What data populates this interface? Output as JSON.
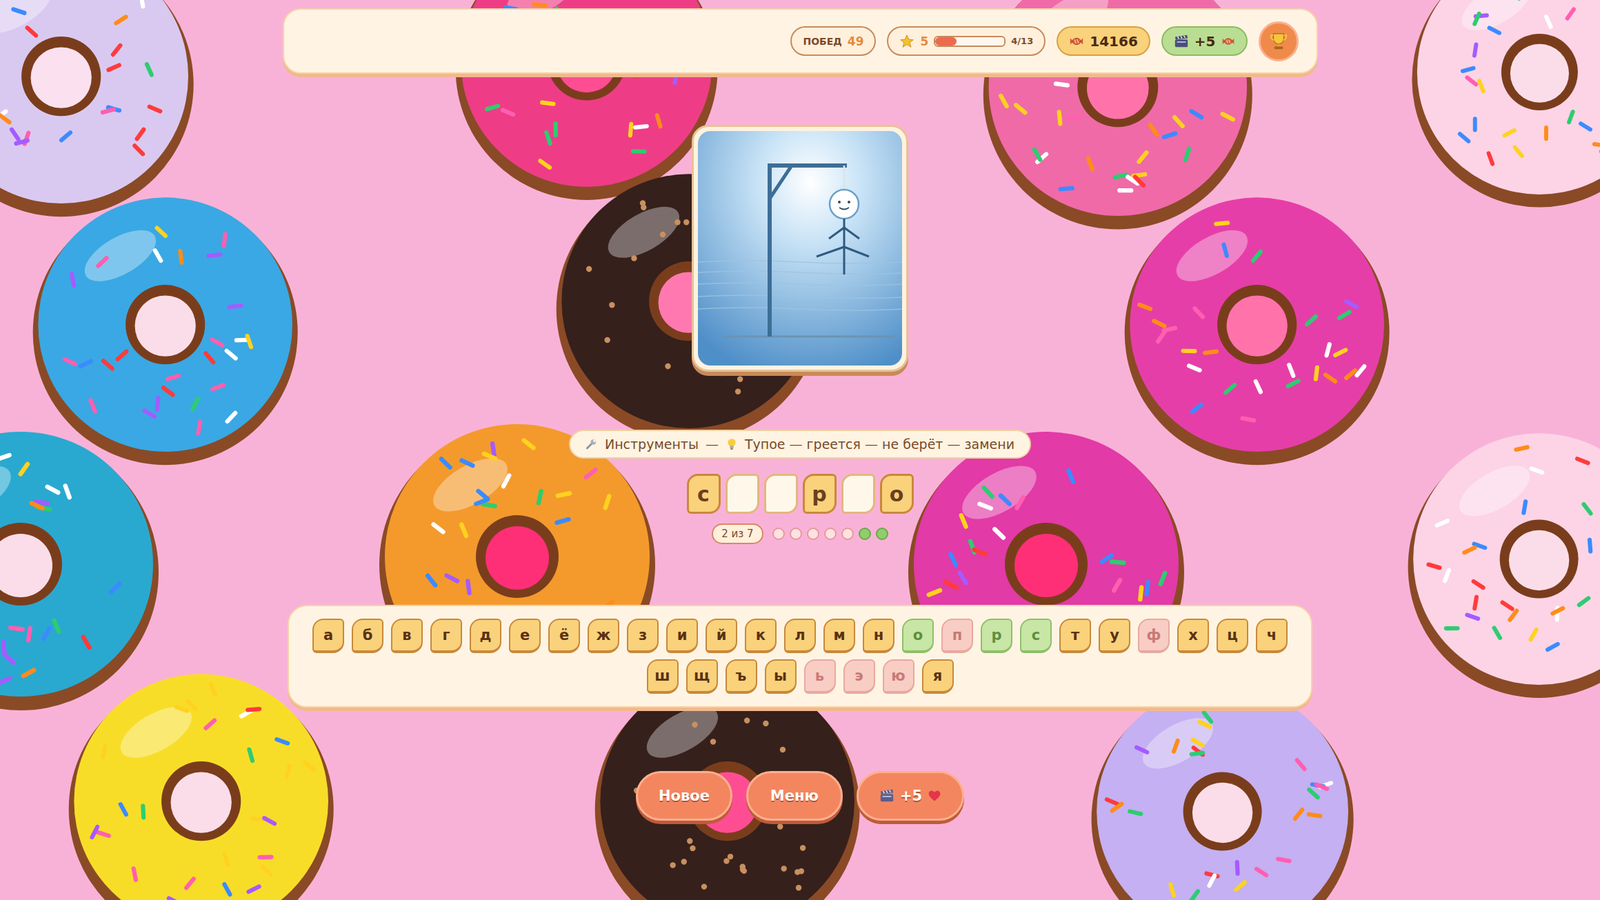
{
  "top_bar": {
    "wins_label": "ПОБЕД",
    "wins": "49",
    "level": "5",
    "xp": {
      "level": 0.31,
      "reading": "4/13"
    },
    "candies": "14166",
    "reward": "+5"
  },
  "hint": {
    "category": "Инструменты",
    "separator": "—",
    "text": "Тупое — греется — не берёт — замени"
  },
  "word": [
    {
      "letter": "с",
      "revealed": true
    },
    {
      "letter": "",
      "revealed": false
    },
    {
      "letter": "",
      "revealed": false
    },
    {
      "letter": "р",
      "revealed": true
    },
    {
      "letter": "",
      "revealed": false
    },
    {
      "letter": "о",
      "revealed": true
    }
  ],
  "attempts": {
    "reading": "2 из 7",
    "dots": [
      {
        "filled": false
      },
      {
        "filled": false
      },
      {
        "filled": false
      },
      {
        "filled": false
      },
      {
        "filled": false
      },
      {
        "filled": true
      },
      {
        "filled": true
      }
    ]
  },
  "keyboard": {
    "rows": [
      [
        {
          "key": "а",
          "status": "unused"
        },
        {
          "key": "б",
          "status": "unused"
        },
        {
          "key": "в",
          "status": "unused"
        },
        {
          "key": "г",
          "status": "unused"
        },
        {
          "key": "д",
          "status": "unused"
        },
        {
          "key": "е",
          "status": "unused"
        },
        {
          "key": "ё",
          "status": "unused"
        },
        {
          "key": "ж",
          "status": "unused"
        },
        {
          "key": "з",
          "status": "unused"
        },
        {
          "key": "и",
          "status": "unused"
        },
        {
          "key": "й",
          "status": "unused"
        },
        {
          "key": "к",
          "status": "unused"
        },
        {
          "key": "л",
          "status": "unused"
        },
        {
          "key": "м",
          "status": "unused"
        },
        {
          "key": "н",
          "status": "unused"
        },
        {
          "key": "о",
          "status": "correct"
        },
        {
          "key": "п",
          "status": "wrong"
        },
        {
          "key": "р",
          "status": "correct"
        },
        {
          "key": "с",
          "status": "correct"
        },
        {
          "key": "т",
          "status": "unused"
        },
        {
          "key": "у",
          "status": "unused"
        },
        {
          "key": "ф",
          "status": "wrong"
        },
        {
          "key": "х",
          "status": "unused"
        },
        {
          "key": "ц",
          "status": "unused"
        },
        {
          "key": "ч",
          "status": "unused"
        }
      ],
      [
        {
          "key": "ш",
          "status": "unused"
        },
        {
          "key": "щ",
          "status": "unused"
        },
        {
          "key": "ъ",
          "status": "unused"
        },
        {
          "key": "ы",
          "status": "unused"
        },
        {
          "key": "ь",
          "status": "wrong"
        },
        {
          "key": "э",
          "status": "wrong"
        },
        {
          "key": "ю",
          "status": "wrong"
        },
        {
          "key": "я",
          "status": "unused"
        }
      ]
    ]
  },
  "buttons": [
    {
      "label": "Новое",
      "kind": "text"
    },
    {
      "label": "Меню",
      "kind": "text"
    },
    {
      "label": "+5",
      "kind": "reward"
    }
  ]
}
